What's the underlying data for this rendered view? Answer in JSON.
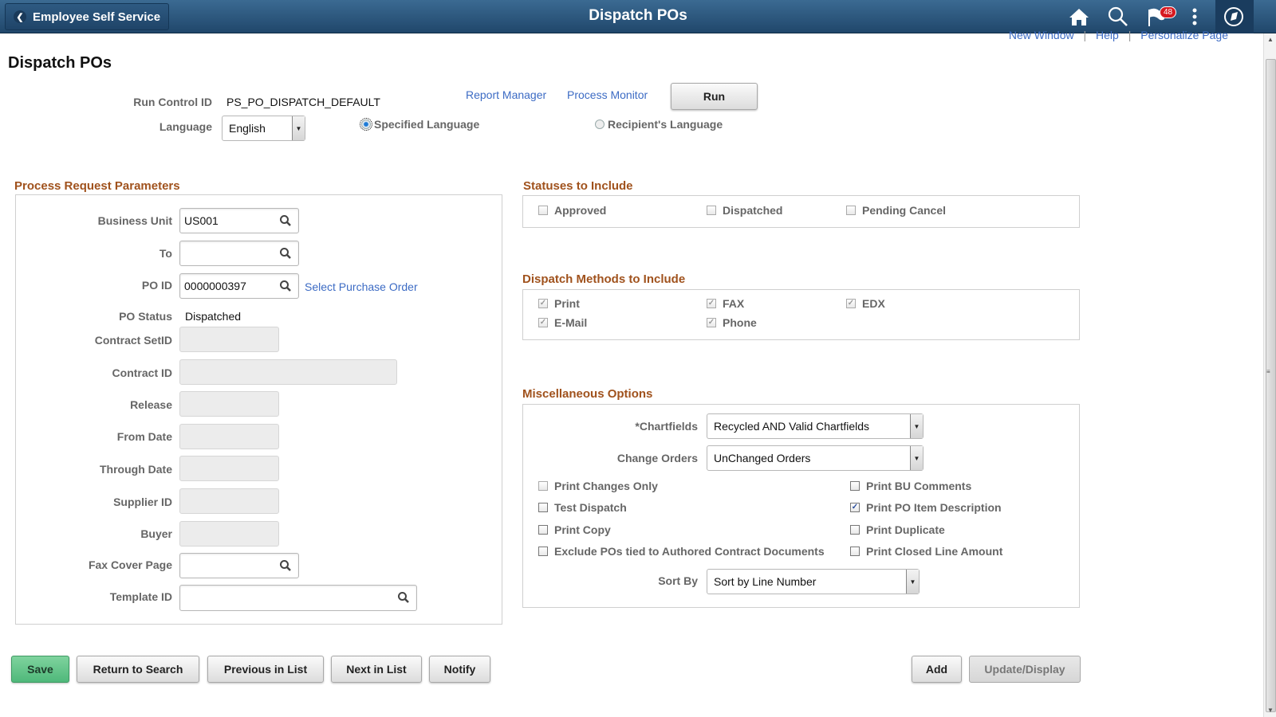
{
  "header": {
    "back_label": "Employee Self Service",
    "title": "Dispatch POs",
    "notification_count": "48",
    "icons": [
      "home-icon",
      "search-icon",
      "notification-flag-icon",
      "actions-menu-icon",
      "navbar-compass-icon"
    ]
  },
  "toplinks": {
    "new_window": "New Window",
    "help": "Help",
    "personalize": "Personalize Page",
    "separator": "|"
  },
  "page": {
    "title": "Dispatch POs"
  },
  "run_control": {
    "label": "Run Control ID",
    "value": "PS_PO_DISPATCH_DEFAULT",
    "report_manager": "Report Manager",
    "process_monitor": "Process Monitor",
    "run_label": "Run",
    "language_label": "Language",
    "language_value": "English",
    "radio_specified": "Specified Language",
    "radio_recipient": "Recipient's Language",
    "selected_radio": "Specified Language"
  },
  "process_params": {
    "heading": "Process Request Parameters",
    "business_unit_label": "Business Unit",
    "business_unit_value": "US001",
    "to_label": "To",
    "to_value": "",
    "po_id_label": "PO ID",
    "po_id_value": "0000000397",
    "select_po_link": "Select Purchase Order",
    "po_status_label": "PO Status",
    "po_status_value": "Dispatched",
    "contract_setid_label": "Contract SetID",
    "contract_id_label": "Contract ID",
    "release_label": "Release",
    "from_date_label": "From Date",
    "through_date_label": "Through Date",
    "supplier_id_label": "Supplier ID",
    "buyer_label": "Buyer",
    "fax_cover_label": "Fax Cover Page",
    "template_id_label": "Template ID"
  },
  "statuses": {
    "heading": "Statuses to Include",
    "items": [
      {
        "label": "Approved",
        "checked": false
      },
      {
        "label": "Dispatched",
        "checked": false
      },
      {
        "label": "Pending Cancel",
        "checked": false
      }
    ]
  },
  "dispatch_methods": {
    "heading": "Dispatch Methods to Include",
    "items": [
      {
        "label": "Print",
        "checked": true
      },
      {
        "label": "FAX",
        "checked": true
      },
      {
        "label": "EDX",
        "checked": true
      },
      {
        "label": "E-Mail",
        "checked": true
      },
      {
        "label": "Phone",
        "checked": true
      }
    ]
  },
  "misc": {
    "heading": "Miscellaneous Options",
    "chartfields_label": "*Chartfields",
    "chartfields_value": "Recycled AND Valid Chartfields",
    "change_orders_label": "Change Orders",
    "change_orders_value": "UnChanged Orders",
    "options": [
      {
        "label": "Print Changes Only",
        "checked": false
      },
      {
        "label": "Print BU Comments",
        "checked": false
      },
      {
        "label": "Test Dispatch",
        "checked": false
      },
      {
        "label": "Print PO Item Description",
        "checked": true
      },
      {
        "label": "Print Copy",
        "checked": false
      },
      {
        "label": "Print Duplicate",
        "checked": false
      },
      {
        "label": "Exclude POs tied to Authored Contract Documents",
        "checked": false
      },
      {
        "label": "Print Closed Line Amount",
        "checked": false
      }
    ],
    "sort_by_label": "Sort By",
    "sort_by_value": "Sort by Line Number"
  },
  "footer": {
    "save": "Save",
    "return_to_search": "Return to Search",
    "previous_in_list": "Previous in List",
    "next_in_list": "Next in List",
    "notify": "Notify",
    "add": "Add",
    "update_display": "Update/Display"
  },
  "check_glyph": "✓"
}
